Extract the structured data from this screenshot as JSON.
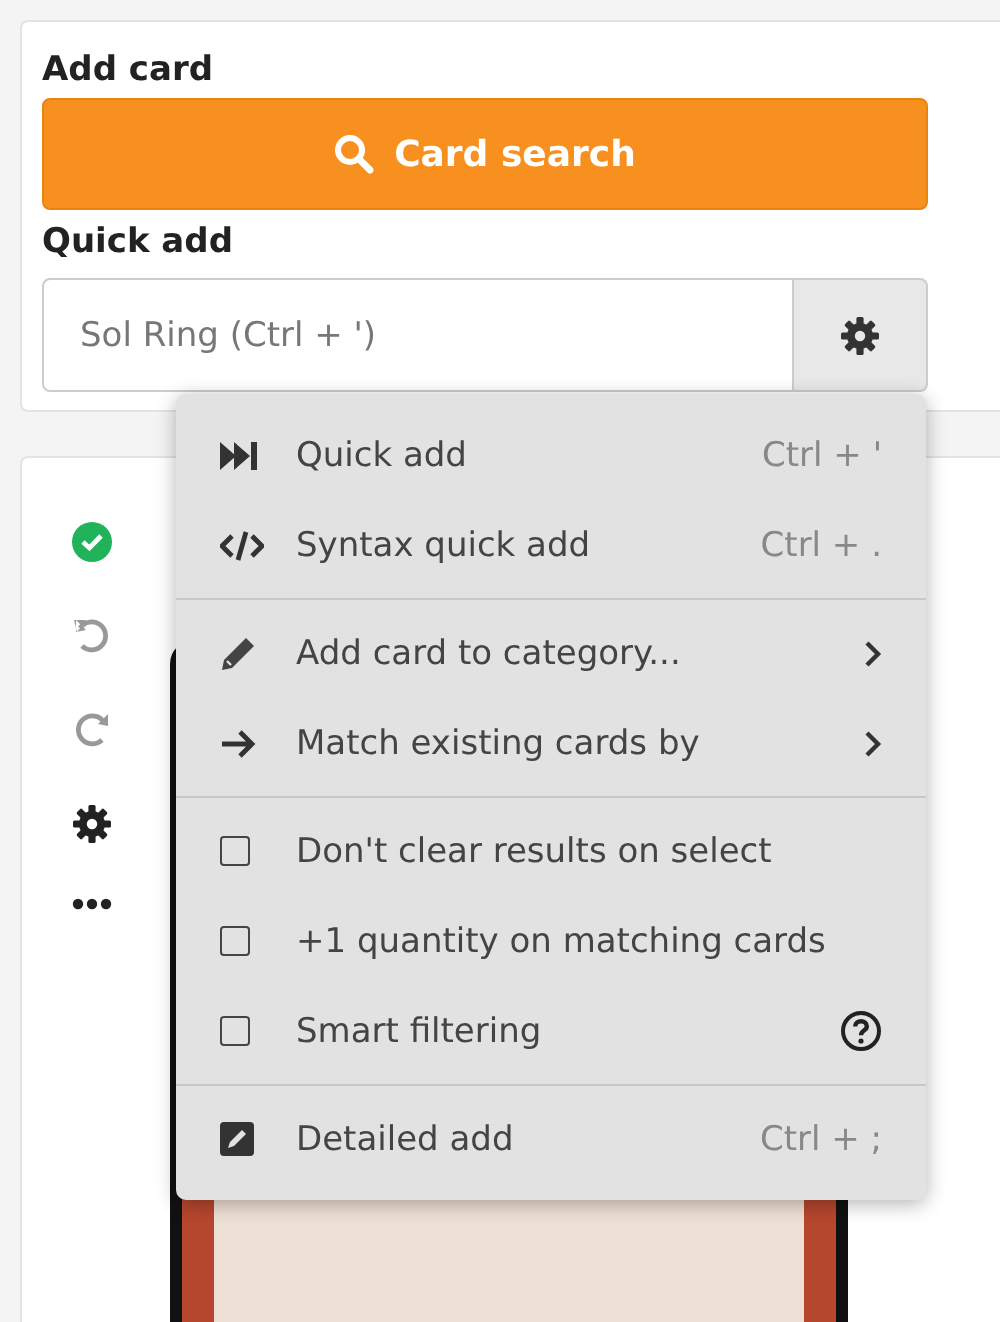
{
  "add_card": {
    "title": "Add card",
    "search_button": "Card search"
  },
  "quick_add": {
    "title": "Quick add",
    "placeholder": "Sol Ring (Ctrl + ')"
  },
  "menu": {
    "sections": [
      {
        "items": [
          {
            "kind": "action",
            "label": "Quick add",
            "shortcut": "Ctrl + '"
          },
          {
            "kind": "action",
            "label": "Syntax quick add",
            "shortcut": "Ctrl + ."
          }
        ]
      },
      {
        "items": [
          {
            "kind": "submenu",
            "label": "Add card to category..."
          },
          {
            "kind": "submenu",
            "label": "Match existing cards by"
          }
        ]
      },
      {
        "items": [
          {
            "kind": "checkbox",
            "label": "Don't clear results on select",
            "checked": false,
            "help": false
          },
          {
            "kind": "checkbox",
            "label": "+1 quantity on matching cards",
            "checked": false,
            "help": false
          },
          {
            "kind": "checkbox",
            "label": "Smart filtering",
            "checked": false,
            "help": true
          }
        ]
      },
      {
        "items": [
          {
            "kind": "action",
            "label": "Detailed add",
            "shortcut": "Ctrl + ;"
          }
        ]
      }
    ]
  }
}
